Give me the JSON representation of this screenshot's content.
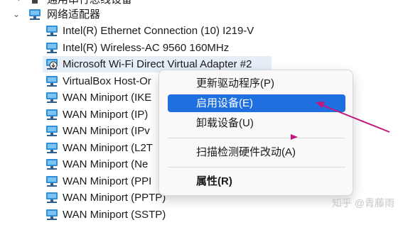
{
  "tree": {
    "partial_top_label": "通用串行总线设备",
    "category_label": "网络适配器",
    "devices": [
      {
        "label": "Intel(R) Ethernet Connection (10) I219-V"
      },
      {
        "label": "Intel(R) Wireless-AC 9560 160MHz"
      },
      {
        "label": "Microsoft Wi-Fi Direct Virtual Adapter #2",
        "disabled": true,
        "selected": true
      },
      {
        "label": "VirtualBox Host-Or"
      },
      {
        "label": "WAN Miniport (IKE"
      },
      {
        "label": "WAN Miniport (IP)"
      },
      {
        "label": "WAN Miniport (IPv"
      },
      {
        "label": "WAN Miniport (L2T"
      },
      {
        "label": "WAN Miniport (Ne"
      },
      {
        "label": "WAN Miniport (PPI"
      },
      {
        "label": "WAN Miniport (PPTP)"
      },
      {
        "label": "WAN Miniport (SSTP)"
      }
    ]
  },
  "context_menu": {
    "update_driver": "更新驱动程序(P)",
    "enable_device": "启用设备(E)",
    "uninstall_device": "卸载设备(U)",
    "scan_hardware": "扫描检测硬件改动(A)",
    "properties": "属性(R)"
  },
  "watermark": "知乎 @青藤雨",
  "colors": {
    "highlight": "#1f6fe0",
    "annotation_arrow": "#c2177e",
    "selection_background": "#e6eef8"
  },
  "icons": {
    "network_adapter": "network-adapter-icon",
    "disabled_badge": "down-arrow-badge-icon"
  }
}
